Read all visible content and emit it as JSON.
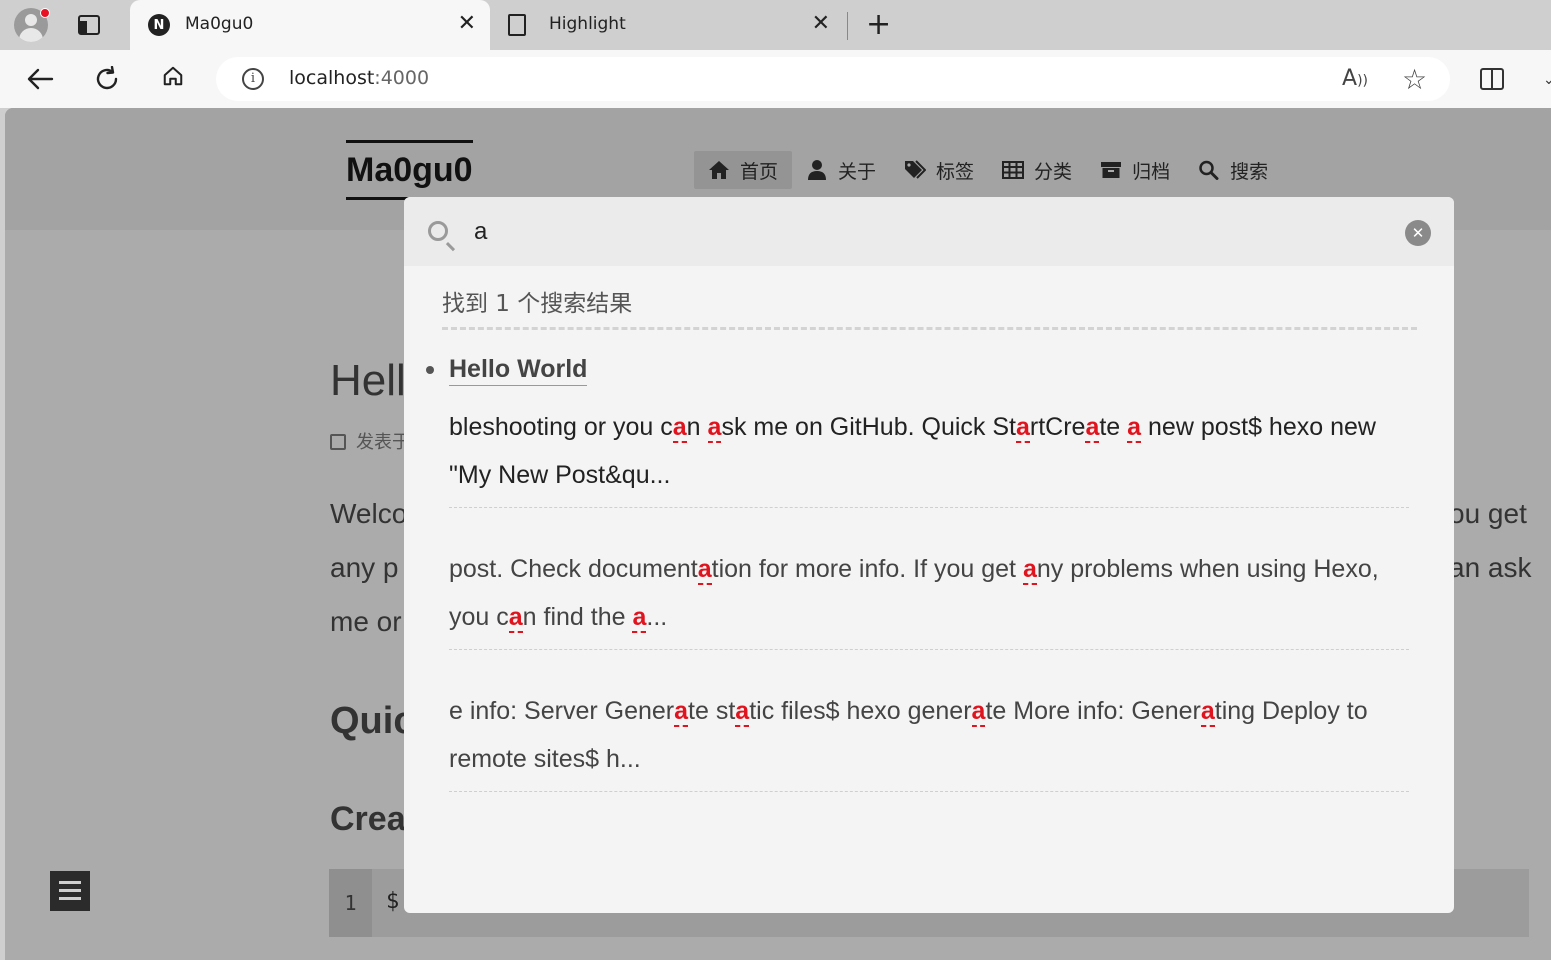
{
  "browser": {
    "tabs": [
      {
        "title": "Ma0gu0",
        "favicon": "N",
        "active": true
      },
      {
        "title": "Highlight",
        "active": false
      }
    ],
    "new_tab_glyph": "+",
    "close_glyph": "✕",
    "address": {
      "host": "localhost",
      "port": ":4000"
    },
    "icons": [
      "profile-icon",
      "tab-actions-icon",
      "back-icon",
      "refresh-icon",
      "home-icon",
      "site-info-icon",
      "read-aloud-icon",
      "favorite-star-icon",
      "split-screen-icon"
    ]
  },
  "site": {
    "brand": "Ma0gu0",
    "menu": [
      {
        "label": "首页",
        "icon": "home-icon",
        "active": true
      },
      {
        "label": "关于",
        "icon": "user-icon"
      },
      {
        "label": "标签",
        "icon": "tags-icon"
      },
      {
        "label": "分类",
        "icon": "grid-icon"
      },
      {
        "label": "归档",
        "icon": "archive-icon"
      },
      {
        "label": "搜索",
        "icon": "search-icon"
      }
    ]
  },
  "background_post": {
    "title": "Hell",
    "meta": "发表于",
    "para_lines_left": [
      "Welco",
      "any p",
      "me or"
    ],
    "para_lines_right": [
      "ou get",
      "an ask"
    ],
    "h2_quick": "Quic",
    "h3_create": "Crea",
    "code_line_no": "1",
    "code_text": "$"
  },
  "search": {
    "query": "a",
    "clear_glyph": "✕",
    "result_count": "找到 1 个搜索结果",
    "results": [
      {
        "title": "Hello World",
        "excerpts": [
          [
            {
              "t": "bleshooting or you c"
            },
            {
              "t": "a",
              "hl": true
            },
            {
              "t": "n "
            },
            {
              "t": "a",
              "hl": true
            },
            {
              "t": "sk me on GitHub. Quick St"
            },
            {
              "t": "a",
              "hl": true
            },
            {
              "t": "rtCre"
            },
            {
              "t": "a",
              "hl": true
            },
            {
              "t": "te "
            },
            {
              "t": "a",
              "hl": true
            },
            {
              "t": " new post$ hexo new \"My New Post&qu..."
            }
          ],
          [
            {
              "t": "post. Check document"
            },
            {
              "t": "a",
              "hl": true
            },
            {
              "t": "tion for more info. If you get "
            },
            {
              "t": "a",
              "hl": true
            },
            {
              "t": "ny problems when using Hexo, you c"
            },
            {
              "t": "a",
              "hl": true
            },
            {
              "t": "n find the "
            },
            {
              "t": "a",
              "hl": true
            },
            {
              "t": "..."
            }
          ],
          [
            {
              "t": "e info: Server Gener"
            },
            {
              "t": "a",
              "hl": true
            },
            {
              "t": "te st"
            },
            {
              "t": "a",
              "hl": true
            },
            {
              "t": "tic files$ hexo gener"
            },
            {
              "t": "a",
              "hl": true
            },
            {
              "t": "te More info: Gener"
            },
            {
              "t": "a",
              "hl": true
            },
            {
              "t": "ting Deploy to remote sites$ h..."
            }
          ]
        ]
      }
    ]
  }
}
